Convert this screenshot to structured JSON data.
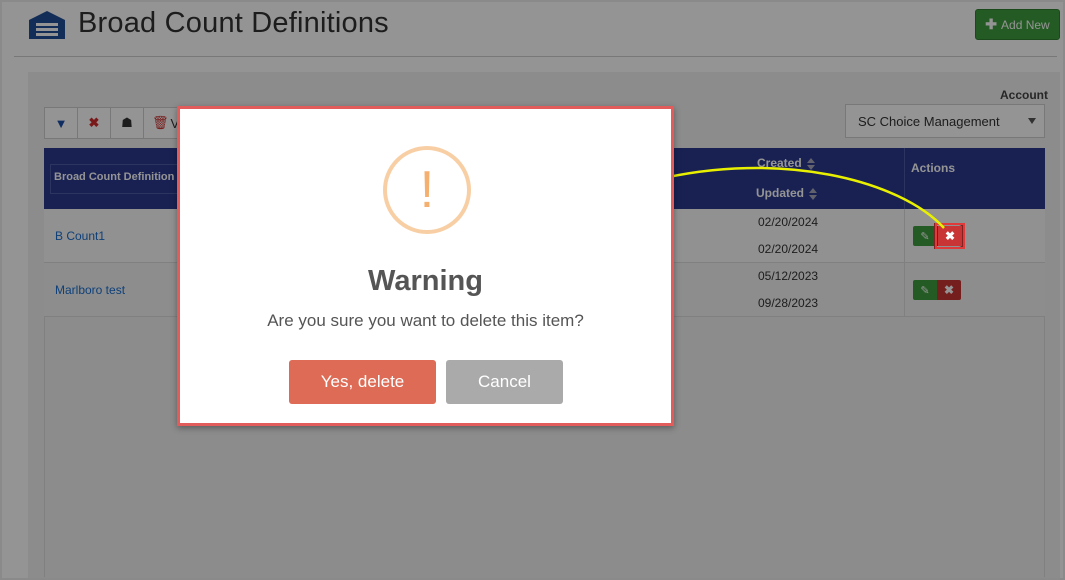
{
  "page": {
    "title": "Broad Count Definitions",
    "add_new_label": "Add New"
  },
  "toolbar": {
    "view_label": "V"
  },
  "account": {
    "label": "Account",
    "selected": "SC Choice Management"
  },
  "table": {
    "columns": {
      "name": "Broad Count Definition N",
      "created": "Created",
      "updated": "Updated",
      "actions": "Actions"
    },
    "rows": [
      {
        "name": "B Count1",
        "created": "02/20/2024",
        "updated": "02/20/2024"
      },
      {
        "name": "Marlboro test",
        "created": "05/12/2023",
        "updated": "09/28/2023"
      }
    ]
  },
  "modal": {
    "icon_text": "!",
    "title": "Warning",
    "message": "Are you sure you want to delete this item?",
    "confirm_label": "Yes, delete",
    "cancel_label": "Cancel"
  },
  "colors": {
    "header_bg": "#2b3a8f",
    "add_new_bg": "#3e9d3e",
    "confirm_bg": "#dd6b55",
    "cancel_bg": "#aaaaaa",
    "warning_icon": "#f5b070",
    "annotation_arrow": "#e8f000",
    "highlight_border": "#e25c5c"
  },
  "icons": {
    "header": "broad-count-icon",
    "filter": "filter-icon",
    "clear": "clear-filter-icon",
    "person": "user-filter-icon",
    "trash": "trash-icon",
    "edit": "pencil-icon",
    "delete": "close-icon"
  }
}
